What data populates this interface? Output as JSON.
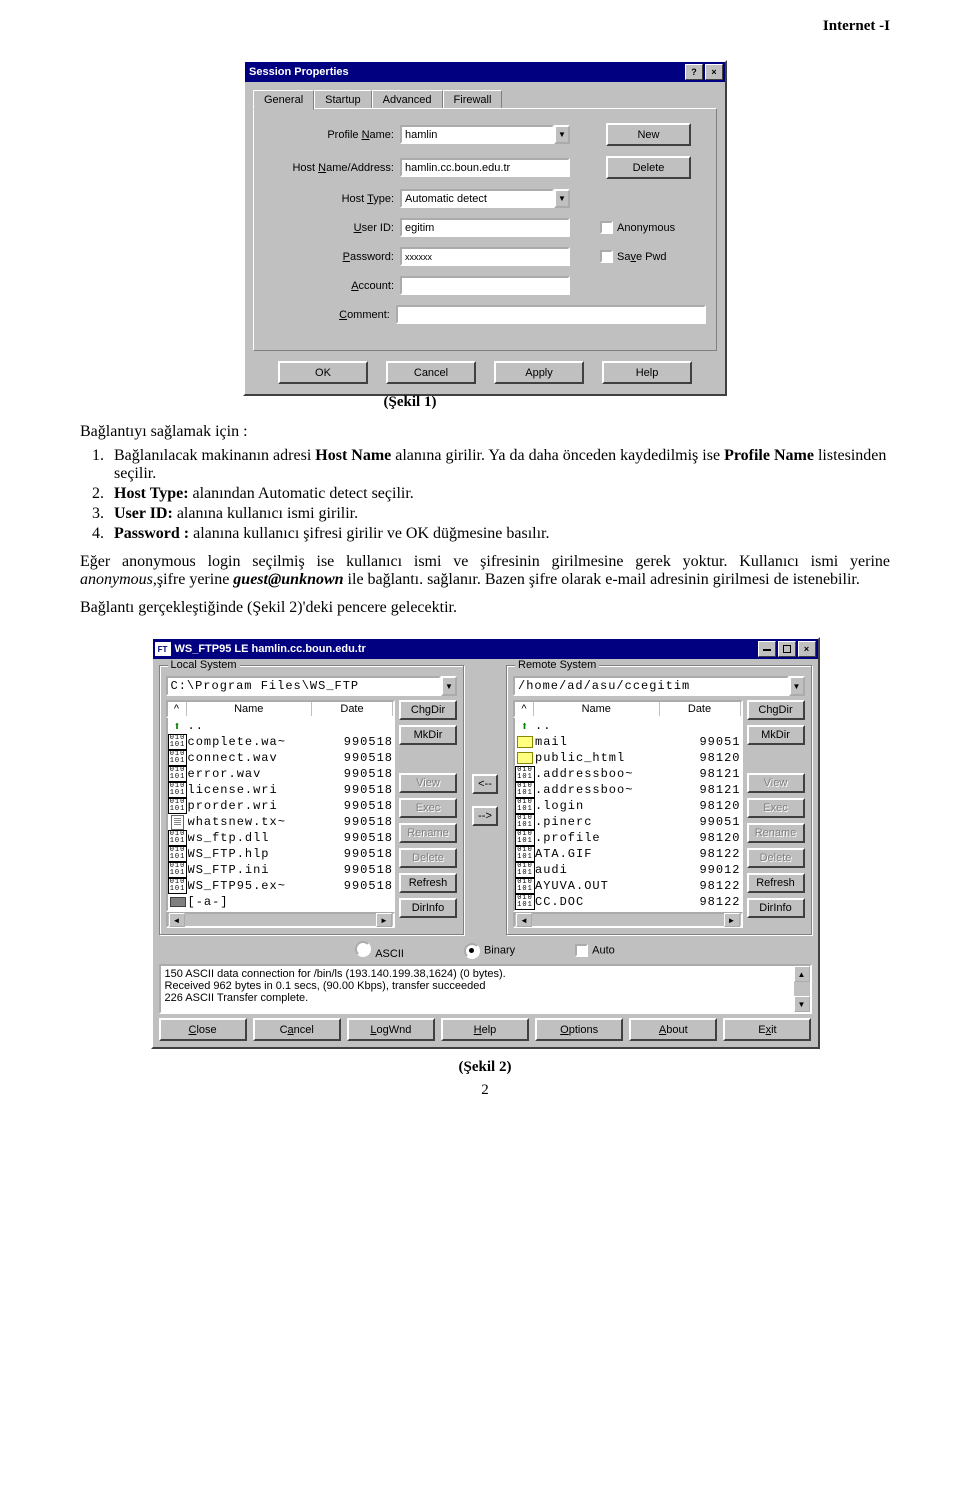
{
  "header": {
    "title": "Internet -I"
  },
  "captions": {
    "fig1": "(Şekil 1)",
    "fig2": "(Şekil 2)"
  },
  "dialog1": {
    "title": "Session Properties",
    "tabs": [
      "General",
      "Startup",
      "Advanced",
      "Firewall"
    ],
    "labels": {
      "profile": "Profile Name:",
      "profile_u": "N",
      "host": "Host Name/Address:",
      "host_u": "N",
      "type": "Host Type:",
      "type_u": "T",
      "user": "User ID:",
      "user_u": "U",
      "pass": "Password:",
      "pass_u": "P",
      "acct": "Account:",
      "acct_u": "A",
      "comment": "Comment:",
      "comment_u": "C"
    },
    "values": {
      "profile": "hamlin",
      "host": "hamlin.cc.boun.edu.tr",
      "type": "Automatic detect",
      "user": "egitim",
      "pass": "xxxxxx",
      "acct": "",
      "comment": ""
    },
    "buttons": {
      "new": "New",
      "delete": "Delete",
      "ok": "OK",
      "cancel": "Cancel",
      "apply": "Apply",
      "help": "Help"
    },
    "checkboxes": {
      "anonymous": "Anonymous",
      "savepwd": "Save Pwd"
    }
  },
  "body": {
    "intro": "Bağlantıyı sağlamak için :",
    "steps": [
      "Bağlanılacak makinanın adresi <b>Host Name</b> alanına girilir. Ya da daha önceden kaydedilmiş ise <b>Profile Name</b> listesinden seçilir.",
      "<b>Host Type:</b> alanından Automatic detect seçilir.",
      "<b>User ID:</b> alanına kullanıcı ismi girilir.",
      "<b>Password :</b> alanına kullanıcı şifresi  girilir ve OK düğmesine basılır."
    ],
    "para1": "Eğer anonymous login seçilmiş ise kullanıcı ismi ve şifresinin girilmesine gerek yoktur. Kullanıcı ismi yerine <i>anonymous</i>,şifre yerine <b><i>guest@unknown</i></b> ile bağlantı. sağlanır. Bazen şifre olarak e-mail adresinin girilmesi de istenebilir.",
    "para2": "Bağlantı gerçekleştiğinde (Şekil 2)'deki  pencere gelecektir."
  },
  "dialog2": {
    "title": "WS_FTP95 LE hamlin.cc.boun.edu.tr",
    "local": {
      "group": "Local System",
      "path": "C:\\Program Files\\WS_FTP",
      "headers": {
        "name": "Name",
        "date": "Date"
      },
      "files": [
        {
          "icon": "up",
          "name": "..",
          "date": ""
        },
        {
          "icon": "bin",
          "name": "complete.wa~",
          "date": "990518"
        },
        {
          "icon": "bin",
          "name": "connect.wav",
          "date": "990518"
        },
        {
          "icon": "bin",
          "name": "error.wav",
          "date": "990518"
        },
        {
          "icon": "bin",
          "name": "license.wri",
          "date": "990518"
        },
        {
          "icon": "bin",
          "name": "prorder.wri",
          "date": "990518"
        },
        {
          "icon": "txt",
          "name": "whatsnew.tx~",
          "date": "990518"
        },
        {
          "icon": "bin",
          "name": "ws_ftp.dll",
          "date": "990518"
        },
        {
          "icon": "bin",
          "name": "WS_FTP.hlp",
          "date": "990518"
        },
        {
          "icon": "bin",
          "name": "WS_FTP.ini",
          "date": "990518"
        },
        {
          "icon": "bin",
          "name": "WS_FTP95.ex~",
          "date": "990518"
        },
        {
          "icon": "drive",
          "name": "[-a-]",
          "date": ""
        }
      ]
    },
    "remote": {
      "group": "Remote System",
      "path": "/home/ad/asu/ccegitim",
      "headers": {
        "name": "Name",
        "date": "Date"
      },
      "files": [
        {
          "icon": "up",
          "name": "..",
          "date": ""
        },
        {
          "icon": "folder",
          "name": "mail",
          "date": "99051"
        },
        {
          "icon": "folder",
          "name": "public_html",
          "date": "98120"
        },
        {
          "icon": "bin",
          "name": ".addressboo~",
          "date": "98121"
        },
        {
          "icon": "bin",
          "name": ".addressboo~",
          "date": "98121"
        },
        {
          "icon": "bin",
          "name": ".login",
          "date": "98120"
        },
        {
          "icon": "bin",
          "name": ".pinerc",
          "date": "99051"
        },
        {
          "icon": "bin",
          "name": ".profile",
          "date": "98120"
        },
        {
          "icon": "bin",
          "name": "ATA.GIF",
          "date": "98122"
        },
        {
          "icon": "bin",
          "name": "audi",
          "date": "99012"
        },
        {
          "icon": "bin",
          "name": "AYUVA.OUT",
          "date": "98122"
        },
        {
          "icon": "bin",
          "name": "CC.DOC",
          "date": "98122"
        }
      ]
    },
    "side_buttons": {
      "chgdir": "ChgDir",
      "mkdir": "MkDir",
      "view": "View",
      "exec": "Exec",
      "rename": "Rename",
      "delete": "Delete",
      "refresh": "Refresh",
      "dirinfo": "DirInfo"
    },
    "transfer": {
      "ascii": "ASCII",
      "binary": "Binary",
      "auto": "Auto"
    },
    "log": [
      "150 ASCII data connection for /bin/ls (193.140.199.38,1624) (0 bytes).",
      "Received 962 bytes in 0.1 secs, (90.00 Kbps), transfer succeeded",
      "226 ASCII Transfer complete."
    ],
    "bottom": {
      "close": "Close",
      "cancel": "Cancel",
      "logwnd": "LogWnd",
      "help": "Help",
      "options": "Options",
      "about": "About",
      "exit": "Exit"
    }
  },
  "page_num": "2"
}
